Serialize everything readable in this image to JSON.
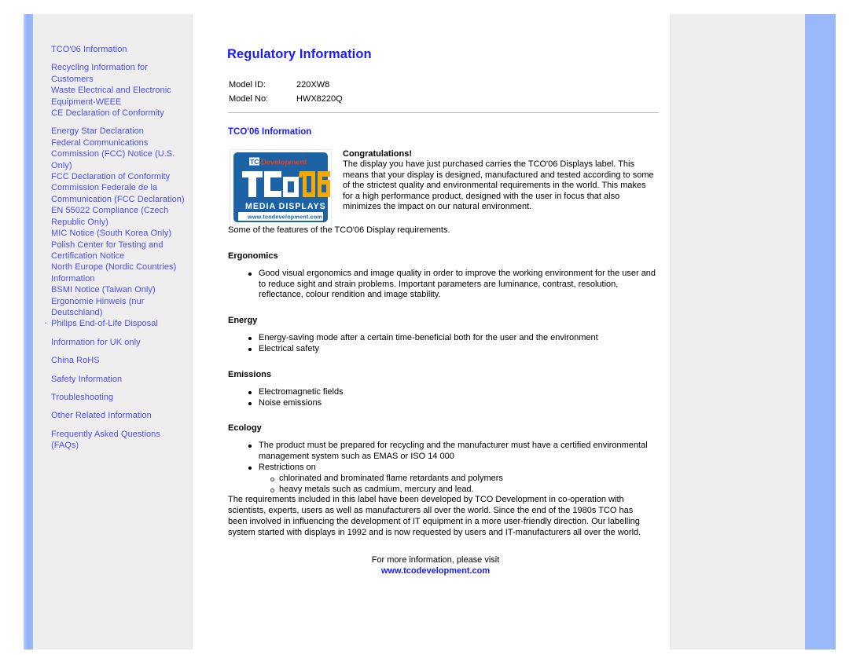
{
  "page": {
    "title": "Regulatory Information",
    "accent_color": "#1a1aff",
    "link_color": "#4c4cf0",
    "sidebar_bg": "#eeeeee",
    "frame_bar_color": "#99b9fa"
  },
  "sidebar": {
    "groups": [
      {
        "items": [
          {
            "label": "TCO'06 Information",
            "bulleted": false
          }
        ]
      },
      {
        "items": [
          {
            "label": "Recycling Information for Customers",
            "bulleted": false
          },
          {
            "label": "Waste Electrical and Electronic Equipment-WEEE",
            "bulleted": false
          },
          {
            "label": "CE Declaration of Conformity",
            "bulleted": false
          }
        ]
      },
      {
        "items": [
          {
            "label": "Energy Star Declaration",
            "bulleted": false
          },
          {
            "label": "Federal Communications Commission (FCC) Notice (U.S. Only)",
            "bulleted": false
          },
          {
            "label": "FCC Declaration of Conformity",
            "bulleted": false
          },
          {
            "label": "Commission Federale de la Communication (FCC Declaration)",
            "bulleted": false
          },
          {
            "label": "EN 55022 Compliance (Czech Republic Only)",
            "bulleted": false
          },
          {
            "label": "MIC Notice (South Korea Only)",
            "bulleted": false
          },
          {
            "label": "Polish Center for Testing and Certification Notice",
            "bulleted": false
          },
          {
            "label": "North Europe (Nordic Countries) Information",
            "bulleted": false
          },
          {
            "label": "BSMI Notice (Taiwan Only)",
            "bulleted": false
          },
          {
            "label": "Ergonomie Hinweis (nur Deutschland)",
            "bulleted": false
          },
          {
            "label": "Philips End-of-Life Disposal",
            "bulleted": true
          }
        ]
      },
      {
        "items": [
          {
            "label": "Information for UK only",
            "bulleted": false
          }
        ]
      },
      {
        "items": [
          {
            "label": "China RoHS",
            "bulleted": false
          }
        ]
      },
      {
        "items": [
          {
            "label": "Safety Information",
            "bulleted": false
          }
        ]
      },
      {
        "items": [
          {
            "label": "Troubleshooting",
            "bulleted": false
          }
        ]
      },
      {
        "items": [
          {
            "label": "Other Related Information",
            "bulleted": false
          }
        ]
      },
      {
        "items": [
          {
            "label": "Frequently Asked Questions (FAQs)",
            "bulleted": false
          }
        ]
      }
    ]
  },
  "main": {
    "heading": "Regulatory Information",
    "model_table": {
      "rows": [
        {
          "key": "Model ID:",
          "value": "220XW8"
        },
        {
          "key": "Model No:",
          "value": "HWX8220Q"
        }
      ]
    },
    "section_title": "TCO'06 Information",
    "logo": {
      "top_band_mark": "TCO",
      "top_band_word": "Development",
      "main_mark": "TCO",
      "main_apostrophe": "'",
      "main_year": "06",
      "sub_line": "MEDIA DISPLAYS",
      "url_line": "www.tcodevelopment.com",
      "bg_color": "#1b63a5",
      "year_color": "#f5a800",
      "band_color": "#1b63a5"
    },
    "congratulations": {
      "heading": "Congratulations!",
      "body": "The display you have just purchased carries the TCO'06 Displays label. This means that your display is designed, manufactured and tested according to some of the strictest quality and environmental requirements in the world. This makes for a high performance product, designed with the user in focus that also minimizes the impact on our natural environment."
    },
    "features_intro": "Some of the features of the TCO'06 Display requirements.",
    "sections": [
      {
        "title": "Ergonomics",
        "items": [
          "Good visual ergonomics and image quality in order to improve the working environment for the user and to reduce sight and strain problems. Important parameters are luminance, contrast, resolution, reflectance, colour rendition and image stability."
        ]
      },
      {
        "title": "Energy",
        "items": [
          "Energy-saving mode after a certain time-beneficial both for the user and the environment",
          "Electrical safety"
        ]
      },
      {
        "title": "Emissions",
        "items": [
          "Electromagnetic fields",
          "Noise emissions"
        ]
      },
      {
        "title": "Ecology",
        "items": [
          "The product must be prepared for recycling and the manufacturer must have a certified environmental management system such as EMAS or ISO 14 000",
          "Restrictions on"
        ],
        "sub_items": [
          "chlorinated and brominated flame retardants and polymers",
          "heavy metals such as cadmium, mercury and lead."
        ]
      }
    ],
    "closing_paragraph": "The requirements included in this label have been developed by TCO Development in co-operation with scientists, experts, users as well as manufacturers all over the world. Since the end of the 1980s TCO has been involved in influencing the development of IT equipment in a more user-friendly direction. Our labelling system started with displays in 1992 and is now requested by users and IT-manufacturers all over the world.",
    "footer": {
      "note": "For more information, please visit",
      "link": "www.tcodevelopment.com"
    }
  }
}
